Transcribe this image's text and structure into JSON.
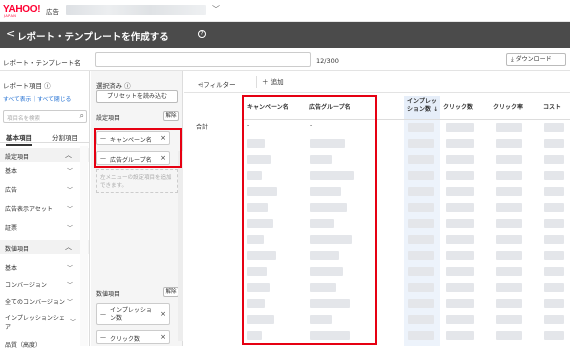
{
  "header": {
    "logo_text": "YAHOO!",
    "logo_sub": "JAPAN",
    "product": "広告",
    "account_chevron": "﹀"
  },
  "titlebar": {
    "back_icon": "<",
    "title": "レポート・テンプレートを作成する",
    "help_icon": "?"
  },
  "name_row": {
    "label": "レポート・テンプレート名",
    "value": "",
    "counter": "12/300",
    "download_label": "ダウンロード"
  },
  "left_panel": {
    "heading": "レポート項目",
    "links": "すべて表示｜すべて閉じる",
    "search_placeholder": "項目名を検索",
    "tabs": [
      "基本項目",
      "分割項目"
    ],
    "groups": [
      {
        "label": "設定項目",
        "items": [
          "基本",
          "広告",
          "広告表示アセット",
          "証票"
        ]
      },
      {
        "label": "数値項目",
        "items": [
          "基本",
          "コンバージョン",
          "全てのコンバージョン",
          "インプレッションシェア",
          "品質（高度）"
        ]
      }
    ]
  },
  "middle_panel": {
    "heading": "選択済み",
    "preset_button": "プリセットを読み込む",
    "settings_section": "設定項目",
    "metrics_section": "数値項目",
    "clear_label": "解除",
    "settings_chips": [
      "キャンペーン名",
      "広告グループ名"
    ],
    "drop_hint": "左メニューの設定項目を追加できます。",
    "metric_chips": [
      "インプレッション数",
      "クリック数"
    ]
  },
  "main": {
    "filter_label": "フィルター",
    "add_label": "追加",
    "columns": [
      "キャンペーン名",
      "広告グループ名",
      "インプレッション数",
      "クリック数",
      "クリック率",
      "コスト"
    ],
    "total_label": "合計",
    "total_values": [
      "-",
      "-"
    ]
  },
  "colors": {
    "accent_red": "#e60012",
    "titlebar": "#4b4b4b",
    "link": "#1a6bd1",
    "highlight_col": "#e6eef9"
  }
}
